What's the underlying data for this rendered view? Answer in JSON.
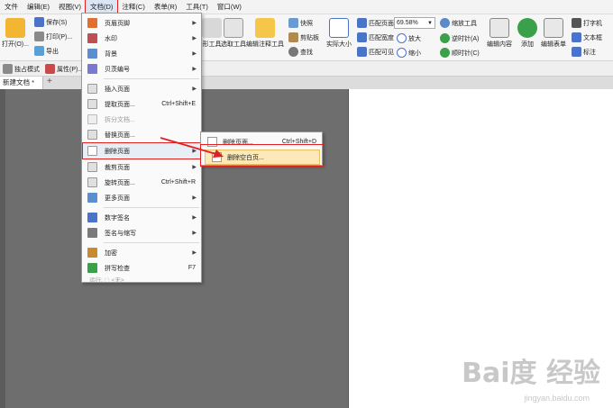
{
  "menubar": [
    "文件",
    "编辑(E)",
    "视图(V)",
    "文档(D)",
    "注释(C)",
    "表单(R)",
    "工具(T)",
    "窗口(W)"
  ],
  "ribbon": {
    "open": "打开(O)...",
    "save": "保存(S)",
    "print": "打印(P)...",
    "export": "导出",
    "hand_tool": "形工具",
    "select_text": "选取工具",
    "edit_annot": "编辑注释工具",
    "snapshot": "快照",
    "clipboard": "剪贴板",
    "find": "查找",
    "actual_size": "实际大小",
    "fit_page": "匹配页面",
    "fit_width": "匹配宽度",
    "fit_visible": "匹配可见",
    "zoom_value": "69.58%",
    "zoom_tool": "缩放工具",
    "zoom_in": "放大",
    "zoom_out": "缩小",
    "rotate_left": "逆时针(A)",
    "rotate_right": "顺时针(C)",
    "edit_content": "编辑内容",
    "add": "添加",
    "edit_form": "编辑表单",
    "typewriter": "打字机",
    "textbox": "文本框",
    "label": "标注"
  },
  "subbar": {
    "standalone": "独占模式",
    "properties": "属性(P)..."
  },
  "tab": {
    "name": "新建文档 *",
    "add": "+"
  },
  "doc_menu": [
    {
      "label": "页眉页脚",
      "arrow": true
    },
    {
      "label": "水印",
      "arrow": true
    },
    {
      "label": "背景",
      "arrow": true
    },
    {
      "label": "贝茨编号",
      "arrow": true
    },
    {
      "label": "插入页面",
      "arrow": true
    },
    {
      "label": "提取页面...",
      "shortcut": "Ctrl+Shift+E"
    },
    {
      "label": "拆分文档...",
      "disabled": true
    },
    {
      "label": "替换页面..."
    },
    {
      "label": "删除页面",
      "arrow": true,
      "highlight": true
    },
    {
      "label": "裁剪页面",
      "arrow": true
    },
    {
      "label": "旋转页面...",
      "shortcut": "Ctrl+Shift+R"
    },
    {
      "label": "更多页面",
      "arrow": true
    },
    {
      "label": "数字签名",
      "arrow": true
    },
    {
      "label": "签名与缩写",
      "arrow": true
    },
    {
      "label": "加密",
      "arrow": true
    },
    {
      "label": "拼写检查",
      "shortcut": "F7"
    },
    {
      "label": "运行: ⬚ <无>",
      "disabled": true
    }
  ],
  "sub_menu": [
    {
      "label": "删除页面...",
      "shortcut": "Ctrl+Shift+D"
    },
    {
      "label": "删除空白页...",
      "highlight": true
    }
  ],
  "watermark": {
    "brand": "Bai度 经验",
    "url": "jingyan.baidu.com"
  },
  "colors": {
    "accent_red": "#e02020",
    "highlight": "#fde9b8",
    "canvas": "#6e6e6e"
  }
}
